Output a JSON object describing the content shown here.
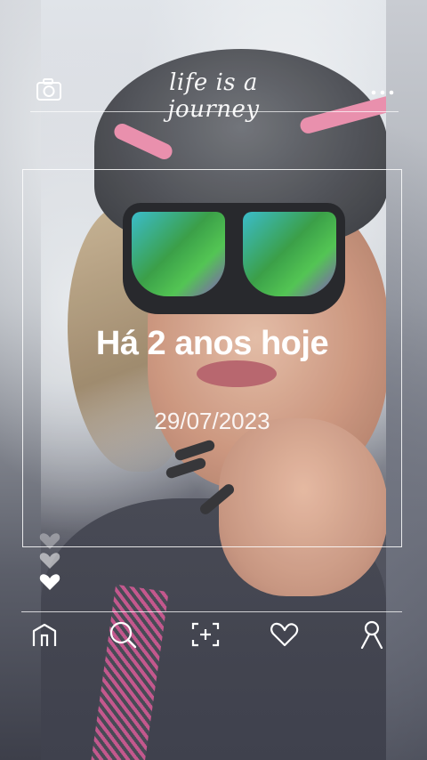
{
  "header": {
    "brand_text": "life is a journey",
    "camera_icon": "camera-icon",
    "more_icon": "more-icon"
  },
  "memory": {
    "headline": "Há 2 anos hoje",
    "date": "29/07/2023"
  },
  "reactions": {
    "icons": [
      "heart-icon",
      "heart-icon",
      "heart-icon"
    ]
  },
  "nav": {
    "items": [
      {
        "icon": "home-icon"
      },
      {
        "icon": "search-icon"
      },
      {
        "icon": "add-icon"
      },
      {
        "icon": "heart-icon"
      },
      {
        "icon": "profile-icon"
      }
    ]
  },
  "colors": {
    "overlay_line": "#ffffff",
    "text": "#ffffff"
  }
}
